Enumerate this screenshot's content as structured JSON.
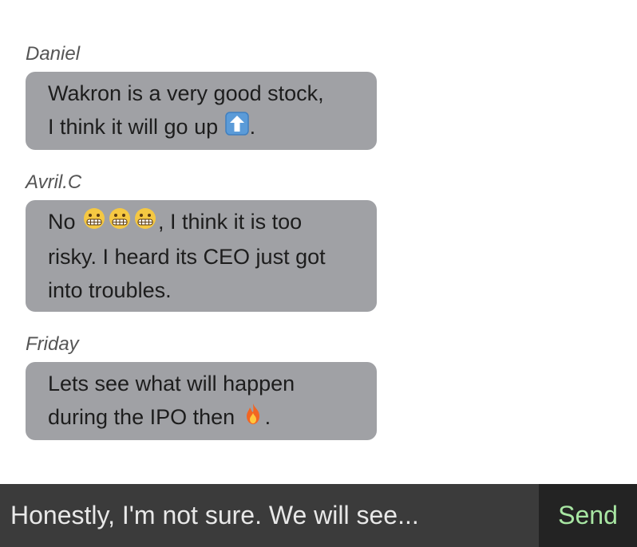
{
  "messages": [
    {
      "sender": "Daniel",
      "lines": [
        "Wakron is a very good stock,",
        "I think it will go up",
        "."
      ],
      "emoji": "up-arrow-icon"
    },
    {
      "sender": "Avril.C",
      "line1_pre": "No ",
      "line1_post": ", I think it is too",
      "line2": "risky. I heard its CEO just got",
      "line3": "into troubles.",
      "emoji": "grimacing-face-icon"
    },
    {
      "sender": "Friday",
      "line1": "Lets see what will happen",
      "line2_pre": "during the IPO then ",
      "line2_post": ".",
      "emoji": "fire-icon"
    }
  ],
  "composer": {
    "value": "Honestly, I'm not sure. We will see...",
    "send_label": "Send"
  },
  "colors": {
    "bubble": "#a0a1a5",
    "input_bg": "#3b3b3b",
    "send_bg": "#232323",
    "send_text": "#a8e6a3"
  }
}
